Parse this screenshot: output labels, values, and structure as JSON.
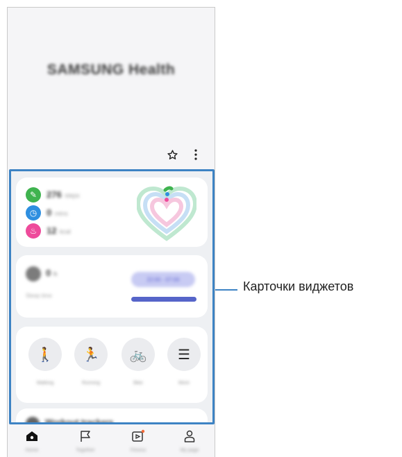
{
  "header": {
    "app_title": "SAMSUNG Health"
  },
  "cards": {
    "activity": {
      "metrics": [
        {
          "icon": "steps-icon",
          "value": "276",
          "unit": "steps",
          "color": "#3fb34f"
        },
        {
          "icon": "clock-icon",
          "value": "0",
          "unit": "mins",
          "color": "#2e8fe0"
        },
        {
          "icon": "flame-icon",
          "value": "12",
          "unit": "kcal",
          "color": "#ee4b9b"
        }
      ]
    },
    "sleep": {
      "value": "0",
      "unit": "h",
      "label": "Sleep time",
      "schedule": "22:00 - 07:00"
    },
    "workouts": {
      "items": [
        {
          "label": "Walking",
          "icon": "walking-icon"
        },
        {
          "label": "Running",
          "icon": "running-icon"
        },
        {
          "label": "Bike",
          "icon": "bike-icon"
        },
        {
          "label": "More",
          "icon": "list-icon"
        }
      ]
    },
    "workout_tracker": {
      "title": "Workout trackers"
    }
  },
  "navbar": {
    "items": [
      {
        "label": "Home",
        "icon": "home-icon"
      },
      {
        "label": "Together",
        "icon": "flag-icon"
      },
      {
        "label": "Fitness",
        "icon": "fitness-icon"
      },
      {
        "label": "My page",
        "icon": "person-icon"
      }
    ]
  },
  "callout": {
    "text": "Карточки виджетов"
  },
  "colors": {
    "highlight": "#3d83c4",
    "badge": "#f26b3a"
  }
}
